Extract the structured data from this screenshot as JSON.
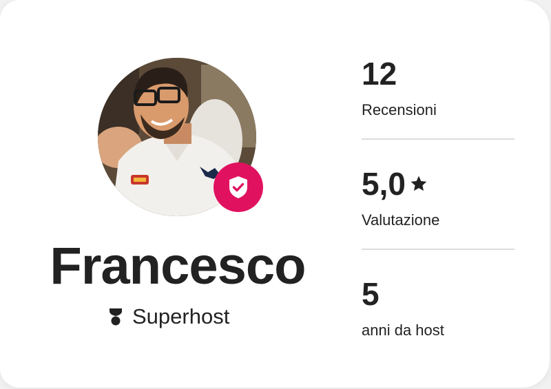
{
  "host": {
    "name": "Francesco",
    "badge_label": "Superhost",
    "badge_icon": "superhost-icon",
    "verified_icon": "verified-shield-icon",
    "accent_color": "#e0125f"
  },
  "stats": [
    {
      "value": "12",
      "label": "Recensioni"
    },
    {
      "value": "5,0",
      "label": "Valutazione",
      "icon": "star-icon"
    },
    {
      "value": "5",
      "label": "anni da host"
    }
  ]
}
